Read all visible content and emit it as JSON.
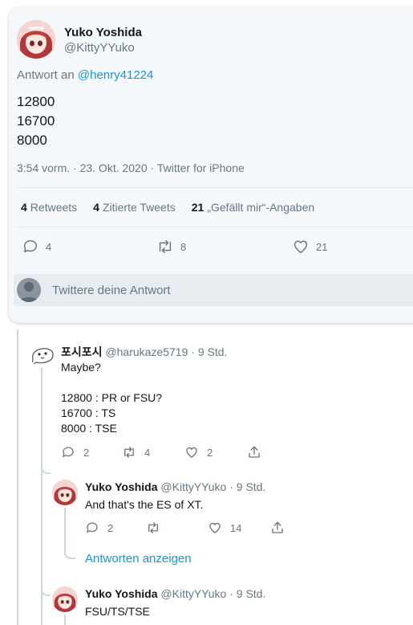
{
  "main_tweet": {
    "author_name": "Yuko Yoshida",
    "author_handle": "@KittyYYuko",
    "reply_to_prefix": "Antwort an",
    "reply_to_mention": "@henry41224",
    "lines": [
      "12800",
      "16700",
      "8000"
    ],
    "meta": "3:54 vorm. · 23. Okt. 2020 · Twitter for iPhone",
    "stats": {
      "retweets_count": "4",
      "retweets_label": "Retweets",
      "quotes_count": "4",
      "quotes_label": "Zitierte Tweets",
      "likes_count": "21",
      "likes_label": "„Gefällt mir“-Angaben"
    },
    "actions": {
      "reply": "4",
      "retweet": "8",
      "like": "21"
    },
    "reply_placeholder": "Twittere deine Antwort"
  },
  "replies": [
    {
      "name": "포시포시",
      "handle": "@harukaze5719",
      "time": "· 9 Std.",
      "text": "Maybe?\n\n12800 : PR or FSU?\n16700 : TS\n8000 : TSE",
      "actions": {
        "reply": "2",
        "retweet": "4",
        "like": "2"
      }
    },
    {
      "name": "Yuko Yoshida",
      "handle": "@KittyYYuko",
      "time": "· 9 Std.",
      "text": "And that's the ES of XT.",
      "actions": {
        "reply": "2",
        "retweet": "",
        "like": "14"
      },
      "show_replies": "Antworten anzeigen"
    },
    {
      "name": "Yuko Yoshida",
      "handle": "@KittyYYuko",
      "time": "· 9 Std.",
      "text": "FSU/TS/TSE"
    }
  ],
  "colors": {
    "accent": "#1b95e0",
    "muted": "#657786",
    "border": "#ccd6dd"
  }
}
